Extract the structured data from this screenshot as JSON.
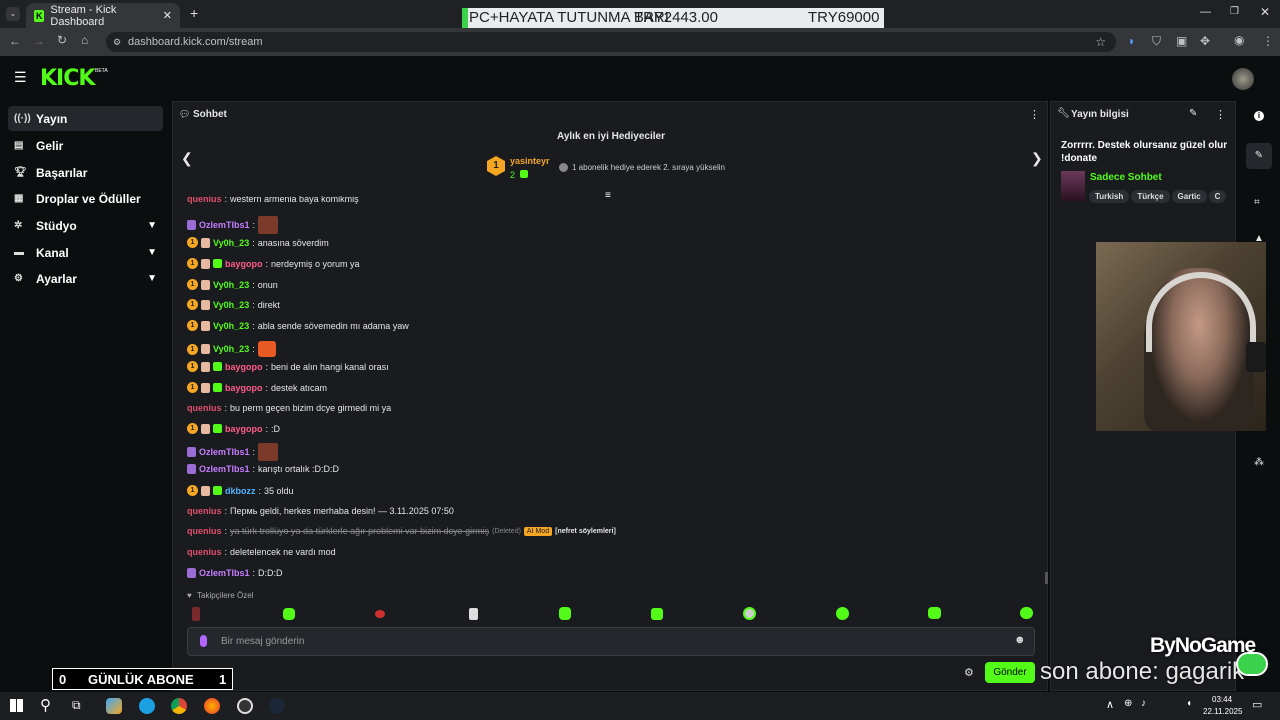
{
  "browser": {
    "tab_title": "Stream - Kick Dashboard",
    "url": "dashboard.kick.com/stream"
  },
  "ticker": {
    "left": "PC+HAYATA TUTUNMA BARI",
    "middle": "TRY2443.00",
    "right": "TRY69000"
  },
  "app": {
    "logo": "KICK",
    "beta": "BETA"
  },
  "sidebar": {
    "items": [
      {
        "label": "Yayın",
        "icon": "broadcast-icon",
        "active": true
      },
      {
        "label": "Gelir",
        "icon": "money-icon"
      },
      {
        "label": "Başarılar",
        "icon": "trophy-icon"
      },
      {
        "label": "Droplar ve Ödüller",
        "icon": "gift-icon"
      },
      {
        "label": "Stüdyo",
        "icon": "studio-icon",
        "expandable": true
      },
      {
        "label": "Kanal",
        "icon": "channel-icon",
        "expandable": true
      },
      {
        "label": "Ayarlar",
        "icon": "gear-icon",
        "expandable": true
      }
    ]
  },
  "chat": {
    "title": "Sohbet",
    "gifters_title": "Aylık en iyi Hediyeciler",
    "top_gifter": {
      "rank": "1",
      "name": "yasinteyr",
      "count": "2"
    },
    "gifter_hint": "1 abonelik hediye ederek 2. sıraya yükselin",
    "messages": [
      {
        "user": "quenius",
        "text": "western armenia baya komikmiş",
        "color": "#e0506e"
      },
      {
        "user": "OzlemTlbs1",
        "text": "",
        "color": "#c77dff"
      },
      {
        "user": "Vy0h_23",
        "text": "anasına söverdim",
        "color": "#53fc18"
      },
      {
        "user": "baygopo",
        "text": "nerdeymiş o yorum ya",
        "color": "#ff5c8a"
      },
      {
        "user": "Vy0h_23",
        "text": "onun",
        "color": "#53fc18"
      },
      {
        "user": "Vy0h_23",
        "text": "direkt",
        "color": "#53fc18"
      },
      {
        "user": "Vy0h_23",
        "text": "abla sende sövemedin mı adama yaw",
        "color": "#53fc18"
      },
      {
        "user": "Vy0h_23",
        "text": "",
        "color": "#53fc18"
      },
      {
        "user": "baygopo",
        "text": "beni de alın hangi kanal orası",
        "color": "#ff5c8a"
      },
      {
        "user": "baygopo",
        "text": "destek atıcam",
        "color": "#ff5c8a"
      },
      {
        "user": "quenius",
        "text": "bu perm geçen bizim dcye girmedi mi ya",
        "color": "#e0506e"
      },
      {
        "user": "baygopo",
        "text": ":D",
        "color": "#ff5c8a"
      },
      {
        "user": "OzlemTlbs1",
        "text": "",
        "color": "#c77dff"
      },
      {
        "user": "OzlemTlbs1",
        "text": "karıştı ortalık :D:D:D",
        "color": "#c77dff"
      },
      {
        "user": "dkbozz",
        "text": "35 oldu",
        "color": "#4fb3ff"
      },
      {
        "user": "quenius",
        "text": "Пермь geldi, herkes merhaba desin! — 3.11.2025 07:50",
        "color": "#e0506e"
      },
      {
        "user": "quenius",
        "text": "ya türk trollüyo ya da türklerle ağır problemi var bizim dcye girmiş",
        "deleted": "(Deleted)",
        "ai": "AI Mod",
        "reason": "[nefret söylemleri]",
        "color": "#e0506e"
      },
      {
        "user": "quenius",
        "text": "deletelencek ne vardı mod",
        "color": "#e0506e"
      },
      {
        "user": "OzlemTlbs1",
        "text": "D:D:D",
        "color": "#c77dff"
      }
    ],
    "followers_only": "Takipçilere Özel",
    "input_placeholder": "Bir mesaj gönderin",
    "send_label": "Gönder"
  },
  "info": {
    "title": "Yayın bilgisi",
    "stream_title": "Zorrrrr. Destek olursanız güzel olur !donate",
    "category": "Sadece Sohbet",
    "tags": [
      "Turkish",
      "Türkçe",
      "Gartic",
      "C"
    ]
  },
  "overlay": {
    "sub_left": "0",
    "sub_label": "GÜNLÜK ABONE",
    "sub_right": "1",
    "last_sub": "son abone: gagarik",
    "brand": "ByNoGame"
  },
  "taskbar": {
    "time": "03:44",
    "date": "22.11.2025"
  },
  "colors": {
    "accent": "#53fc18",
    "panel": "#191b1f"
  }
}
